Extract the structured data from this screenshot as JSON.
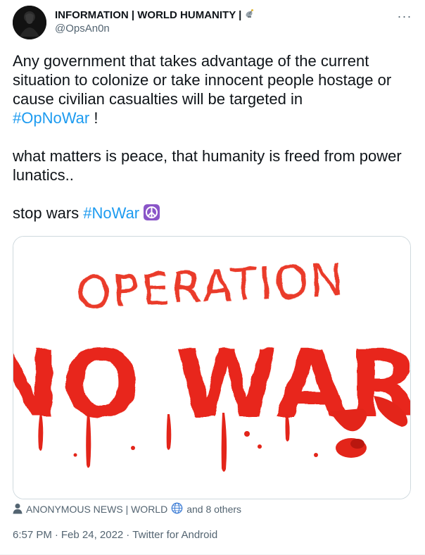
{
  "author": {
    "name": "INFORMATION | WORLD HUMANITY |",
    "handle": "@OpsAn0n",
    "name_emoji": "satellite-antenna-icon"
  },
  "tweet": {
    "line1": "Any government that takes advantage of the current situation to colonize or take innocent people hostage or cause civilian casualties will be targeted in",
    "hashtag1": "#OpNoWar",
    "line1_end": " !",
    "line2": "what matters is peace, that humanity is freed from power lunatics..",
    "line3_prefix": "stop wars ",
    "hashtag2": "#NoWar"
  },
  "media": {
    "line1": "OPERATION",
    "line2": "NO WAR"
  },
  "tags": {
    "first": "ANONYMOUS NEWS | WORLD",
    "others": "and 8 others"
  },
  "meta": {
    "time": "6:57 PM",
    "separator": "·",
    "date": "Feb 24, 2022",
    "source": "Twitter for Android"
  },
  "colors": {
    "accent": "#1d9bf0",
    "secondary_text": "#536471",
    "paint_red": "#e8281a"
  }
}
